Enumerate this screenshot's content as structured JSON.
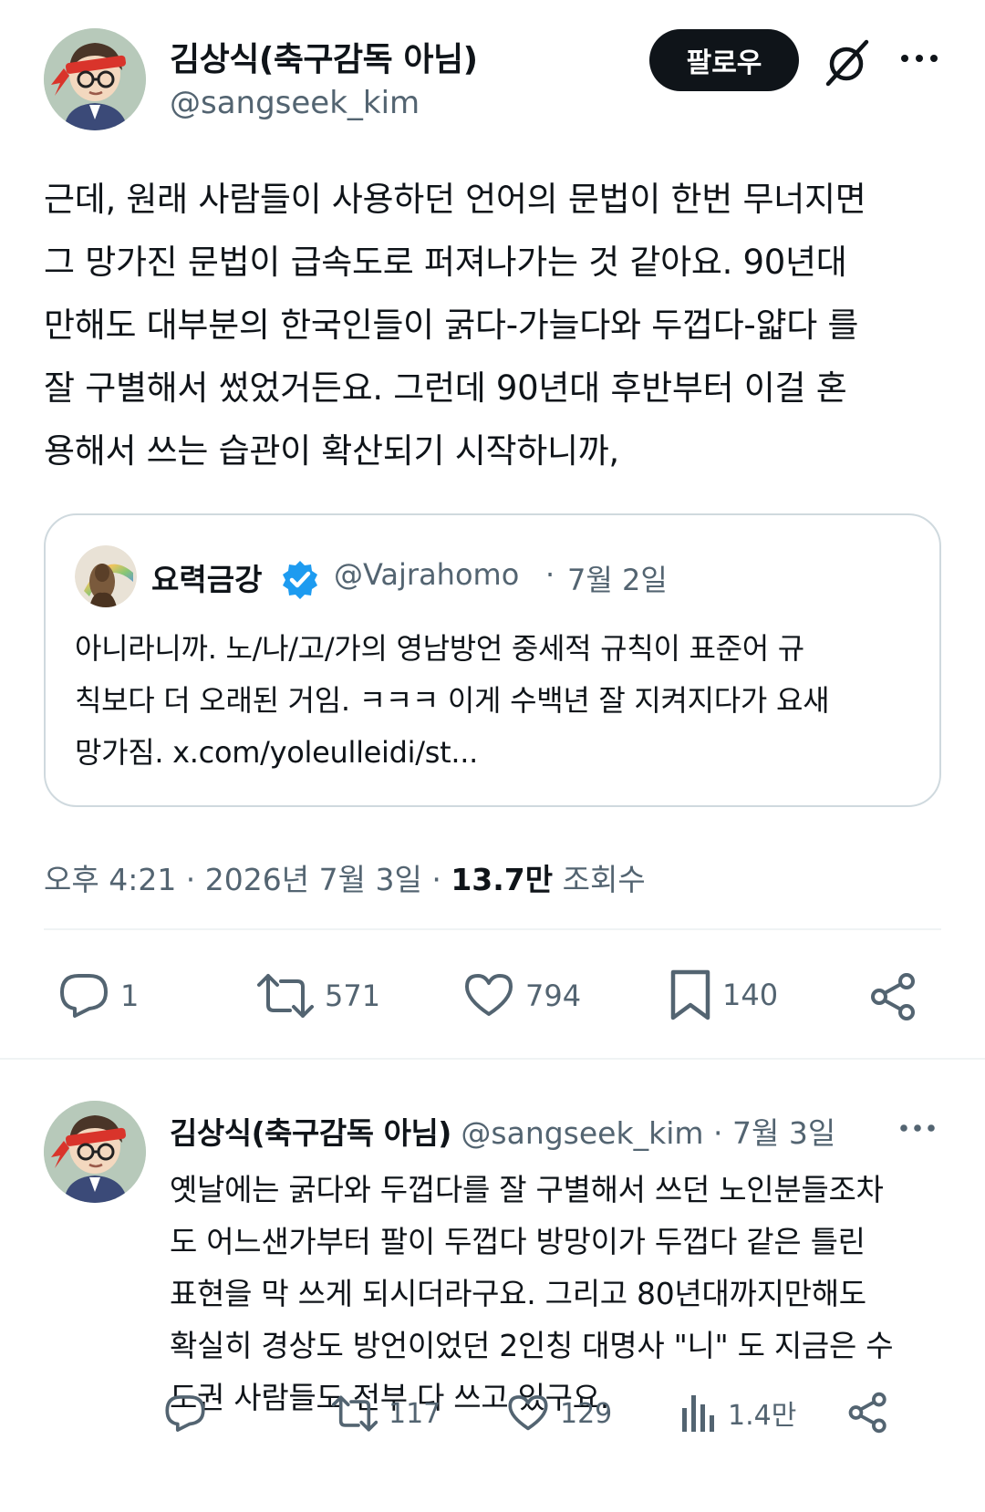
{
  "main_tweet": {
    "author_name": "김상식(축구감독 아님)",
    "author_handle": "@sangseek_kim",
    "follow_label": "팔로우",
    "text": "근데, 원래 사람들이 사용하던 언어의 문법이 한번 무너지면\n그 망가진 문법이 급속도로 퍼져나가는 것 같아요. 90년대\n만해도 대부분의 한국인들이 굵다-가늘다와 두껍다-얇다 를\n잘 구별해서 썼었거든요. 그런데 90년대 후반부터 이걸 혼\n용해서 쓰는 습관이 확산되기 시작하니까,",
    "quote": {
      "name": "요력금강",
      "handle": "@Vajrahomo",
      "separator": "·",
      "date": "7월 2일",
      "text": "아니라니까. 노/나/고/가의 영남방언 중세적 규칙이 표준어 규\n칙보다 더 오래된 거임. ㅋㅋㅋ 이게 수백년 잘 지켜지다가 요새\n망가짐. x.com/yoleulleidi/st..."
    },
    "timestamp": "오후 4:21 · 2026년 7월 3일",
    "separator": "·",
    "views_count": "13.7만",
    "views_label": "조회수",
    "actions": {
      "replies": "1",
      "reposts": "571",
      "likes": "794",
      "bookmarks": "140"
    }
  },
  "reply": {
    "author_name": "김상식(축구감독 아님)",
    "author_handle": "@sangseek_kim",
    "separator": "·",
    "date": "7월 3일",
    "text": "옛날에는 굵다와 두껍다를 잘 구별해서 쓰던 노인분들조차\n도 어느샌가부터 팔이 두껍다 방망이가 두껍다 같은 틀린\n표현을 막 쓰게 되시더라구요. 그리고 80년대까지만해도\n확실히 경상도 방언이었던 2인칭 대명사 \"니\" 도 지금은 수\n도권 사람들도 전부 다 쓰고 있구요.",
    "actions": {
      "replies": "",
      "reposts": "117",
      "likes": "129",
      "views": "1.4만"
    }
  },
  "colors": {
    "text": "#0f1419",
    "secondary": "#536471",
    "border": "#cfd9de",
    "divider": "#eff3f4",
    "verified": "#1d9bf0",
    "avatar_bg": "#b7c9ba",
    "headband": "#d9342b"
  },
  "icons": [
    "grok-icon",
    "more-icon",
    "verified-icon",
    "reply-icon",
    "repost-icon",
    "like-icon",
    "bookmark-icon",
    "share-icon",
    "views-icon"
  ]
}
